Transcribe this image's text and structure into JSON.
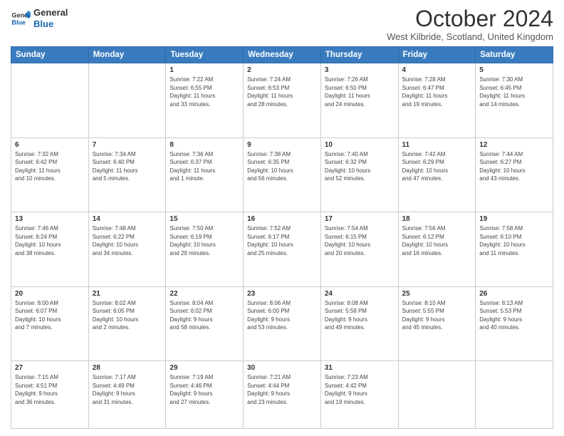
{
  "logo": {
    "line1": "General",
    "line2": "Blue"
  },
  "title": "October 2024",
  "location": "West Kilbride, Scotland, United Kingdom",
  "days_of_week": [
    "Sunday",
    "Monday",
    "Tuesday",
    "Wednesday",
    "Thursday",
    "Friday",
    "Saturday"
  ],
  "weeks": [
    [
      {
        "num": "",
        "info": ""
      },
      {
        "num": "",
        "info": ""
      },
      {
        "num": "1",
        "info": "Sunrise: 7:22 AM\nSunset: 6:55 PM\nDaylight: 11 hours\nand 33 minutes."
      },
      {
        "num": "2",
        "info": "Sunrise: 7:24 AM\nSunset: 6:53 PM\nDaylight: 11 hours\nand 28 minutes."
      },
      {
        "num": "3",
        "info": "Sunrise: 7:26 AM\nSunset: 6:50 PM\nDaylight: 11 hours\nand 24 minutes."
      },
      {
        "num": "4",
        "info": "Sunrise: 7:28 AM\nSunset: 6:47 PM\nDaylight: 11 hours\nand 19 minutes."
      },
      {
        "num": "5",
        "info": "Sunrise: 7:30 AM\nSunset: 6:45 PM\nDaylight: 11 hours\nand 14 minutes."
      }
    ],
    [
      {
        "num": "6",
        "info": "Sunrise: 7:32 AM\nSunset: 6:42 PM\nDaylight: 11 hours\nand 10 minutes."
      },
      {
        "num": "7",
        "info": "Sunrise: 7:34 AM\nSunset: 6:40 PM\nDaylight: 11 hours\nand 5 minutes."
      },
      {
        "num": "8",
        "info": "Sunrise: 7:36 AM\nSunset: 6:37 PM\nDaylight: 11 hours\nand 1 minute."
      },
      {
        "num": "9",
        "info": "Sunrise: 7:38 AM\nSunset: 6:35 PM\nDaylight: 10 hours\nand 56 minutes."
      },
      {
        "num": "10",
        "info": "Sunrise: 7:40 AM\nSunset: 6:32 PM\nDaylight: 10 hours\nand 52 minutes."
      },
      {
        "num": "11",
        "info": "Sunrise: 7:42 AM\nSunset: 6:29 PM\nDaylight: 10 hours\nand 47 minutes."
      },
      {
        "num": "12",
        "info": "Sunrise: 7:44 AM\nSunset: 6:27 PM\nDaylight: 10 hours\nand 43 minutes."
      }
    ],
    [
      {
        "num": "13",
        "info": "Sunrise: 7:46 AM\nSunset: 6:24 PM\nDaylight: 10 hours\nand 38 minutes."
      },
      {
        "num": "14",
        "info": "Sunrise: 7:48 AM\nSunset: 6:22 PM\nDaylight: 10 hours\nand 34 minutes."
      },
      {
        "num": "15",
        "info": "Sunrise: 7:50 AM\nSunset: 6:19 PM\nDaylight: 10 hours\nand 29 minutes."
      },
      {
        "num": "16",
        "info": "Sunrise: 7:52 AM\nSunset: 6:17 PM\nDaylight: 10 hours\nand 25 minutes."
      },
      {
        "num": "17",
        "info": "Sunrise: 7:54 AM\nSunset: 6:15 PM\nDaylight: 10 hours\nand 20 minutes."
      },
      {
        "num": "18",
        "info": "Sunrise: 7:56 AM\nSunset: 6:12 PM\nDaylight: 10 hours\nand 16 minutes."
      },
      {
        "num": "19",
        "info": "Sunrise: 7:58 AM\nSunset: 6:10 PM\nDaylight: 10 hours\nand 11 minutes."
      }
    ],
    [
      {
        "num": "20",
        "info": "Sunrise: 8:00 AM\nSunset: 6:07 PM\nDaylight: 10 hours\nand 7 minutes."
      },
      {
        "num": "21",
        "info": "Sunrise: 8:02 AM\nSunset: 6:05 PM\nDaylight: 10 hours\nand 2 minutes."
      },
      {
        "num": "22",
        "info": "Sunrise: 8:04 AM\nSunset: 6:02 PM\nDaylight: 9 hours\nand 58 minutes."
      },
      {
        "num": "23",
        "info": "Sunrise: 8:06 AM\nSunset: 6:00 PM\nDaylight: 9 hours\nand 53 minutes."
      },
      {
        "num": "24",
        "info": "Sunrise: 8:08 AM\nSunset: 5:58 PM\nDaylight: 9 hours\nand 49 minutes."
      },
      {
        "num": "25",
        "info": "Sunrise: 8:10 AM\nSunset: 5:55 PM\nDaylight: 9 hours\nand 45 minutes."
      },
      {
        "num": "26",
        "info": "Sunrise: 8:13 AM\nSunset: 5:53 PM\nDaylight: 9 hours\nand 40 minutes."
      }
    ],
    [
      {
        "num": "27",
        "info": "Sunrise: 7:15 AM\nSunset: 4:51 PM\nDaylight: 9 hours\nand 36 minutes."
      },
      {
        "num": "28",
        "info": "Sunrise: 7:17 AM\nSunset: 4:49 PM\nDaylight: 9 hours\nand 31 minutes."
      },
      {
        "num": "29",
        "info": "Sunrise: 7:19 AM\nSunset: 4:46 PM\nDaylight: 9 hours\nand 27 minutes."
      },
      {
        "num": "30",
        "info": "Sunrise: 7:21 AM\nSunset: 4:44 PM\nDaylight: 9 hours\nand 23 minutes."
      },
      {
        "num": "31",
        "info": "Sunrise: 7:23 AM\nSunset: 4:42 PM\nDaylight: 9 hours\nand 19 minutes."
      },
      {
        "num": "",
        "info": ""
      },
      {
        "num": "",
        "info": ""
      }
    ]
  ]
}
